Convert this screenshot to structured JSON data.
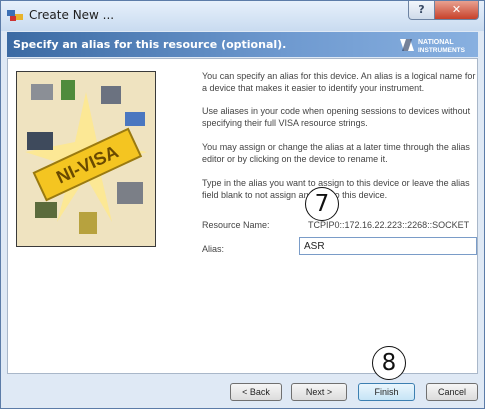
{
  "window": {
    "title": "Create New ...",
    "help_label": "?",
    "close_label": "✕"
  },
  "banner": {
    "heading": "Specify an alias for this resource (optional).",
    "logo_line1": "NATIONAL",
    "logo_line2": "INSTRUMENTS"
  },
  "content": {
    "image_text": "NI-VISA",
    "para1": "You can specify an alias for this device. An alias is a logical name for a device that makes it easier to identify your instrument.",
    "para2": "Use aliases in your code when opening sessions to devices without specifying their full VISA resource strings.",
    "para3": "You may assign or change the alias at a later time through the alias editor or by clicking on the device to rename it.",
    "para4": "Type in the alias you want to assign to this device or leave the alias field blank to not assign an alias to this device.",
    "resource_label": "Resource Name:",
    "resource_value": "TCPIP0::172.16.22.223::2268::SOCKET",
    "alias_label": "Alias:",
    "alias_value": "ASR"
  },
  "callouts": {
    "step7": "7",
    "step8": "8"
  },
  "buttons": {
    "back": "< Back",
    "next": "Next >",
    "finish": "Finish",
    "cancel": "Cancel"
  }
}
